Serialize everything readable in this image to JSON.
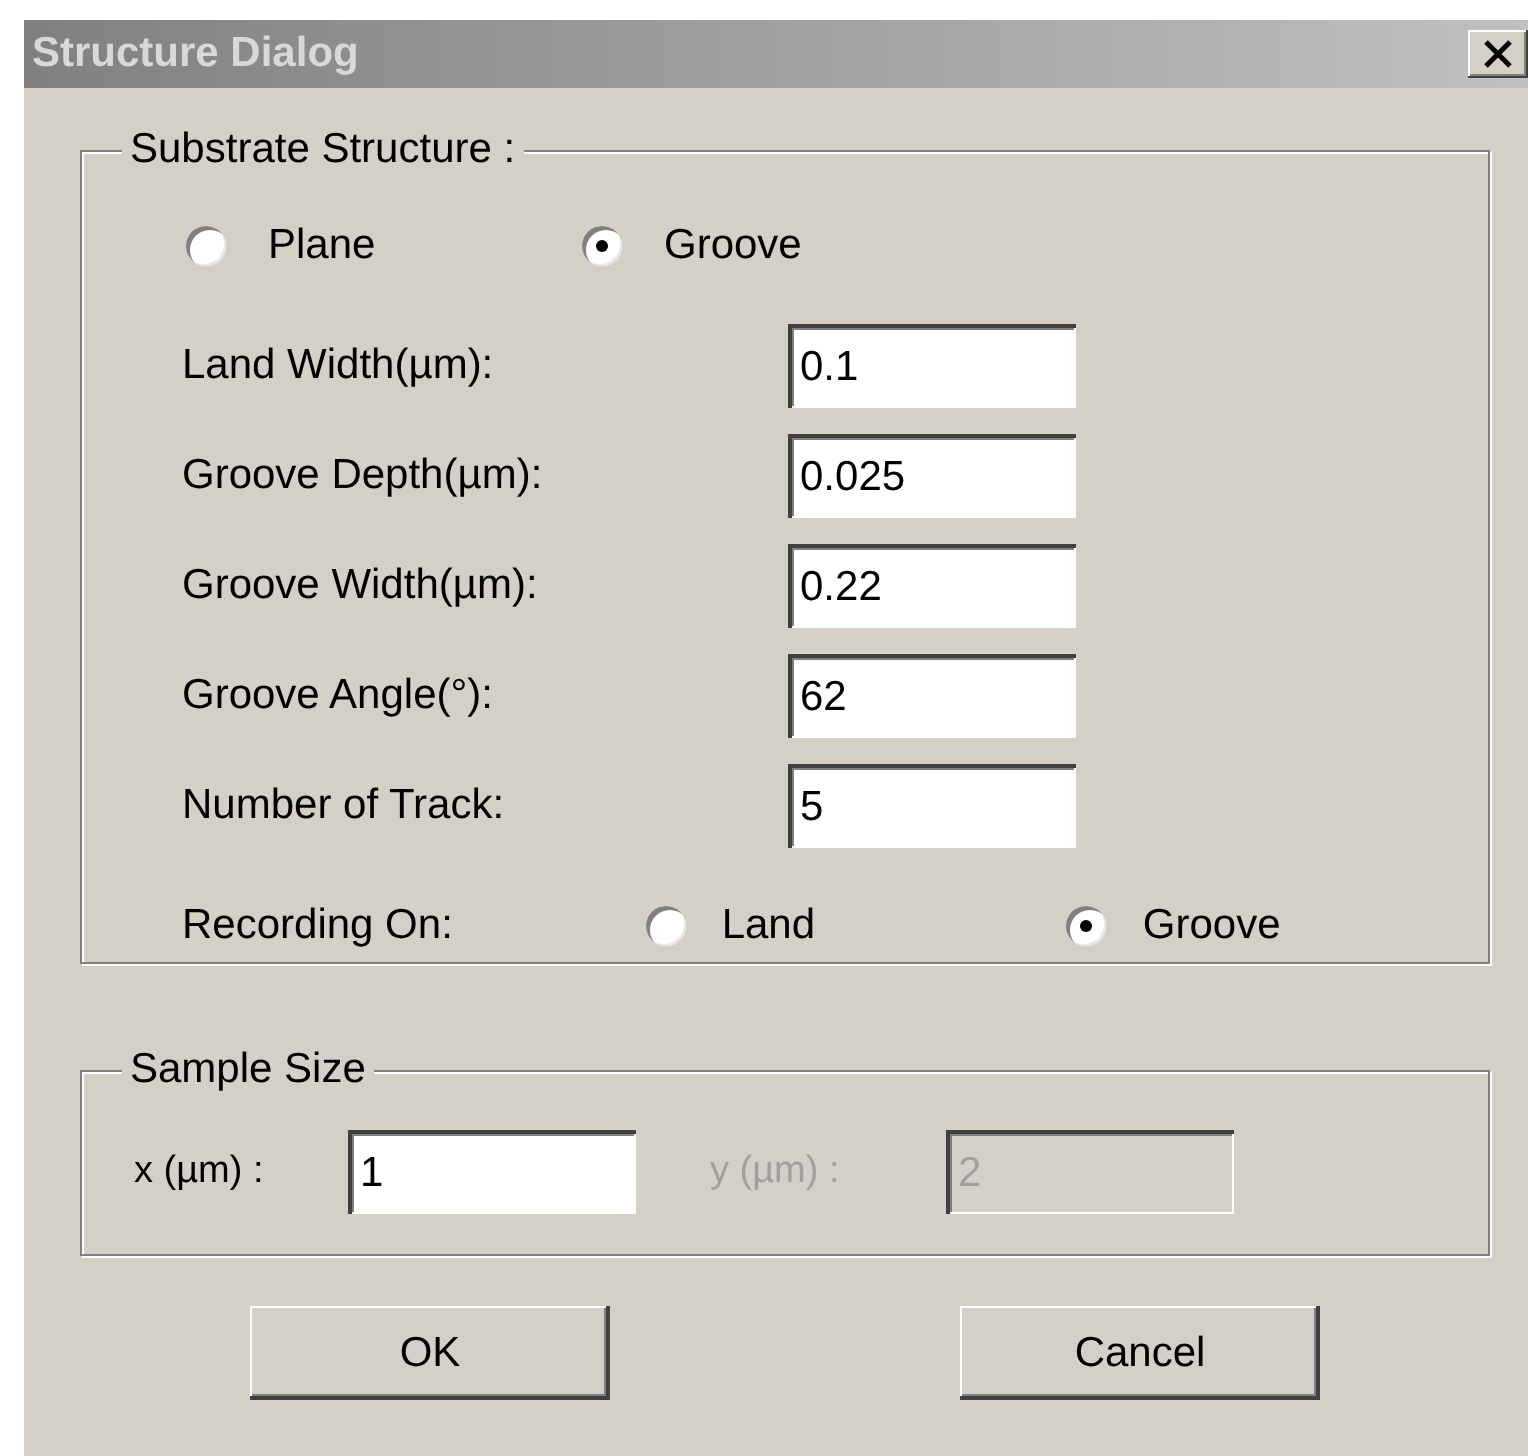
{
  "window": {
    "title": "Structure Dialog"
  },
  "substrate": {
    "legend": "Substrate Structure :",
    "types": [
      {
        "label": "Plane",
        "selected": false
      },
      {
        "label": "Groove",
        "selected": true
      }
    ],
    "fields": [
      {
        "label": "Land Width(µm):",
        "value": "0.1"
      },
      {
        "label": "Groove Depth(µm):",
        "value": "0.025"
      },
      {
        "label": "Groove Width(µm):",
        "value": "0.22"
      },
      {
        "label": "Groove Angle(°):",
        "value": "62"
      },
      {
        "label": "Number of Track:",
        "value": "5"
      }
    ],
    "recording": {
      "label": "Recording On:",
      "options": [
        {
          "label": "Land",
          "selected": false
        },
        {
          "label": "Groove",
          "selected": true
        }
      ]
    }
  },
  "sample_size": {
    "legend": "Sample Size",
    "fields": [
      {
        "label": "x (µm) :",
        "value": "1",
        "disabled": false
      },
      {
        "label": "y (µm) :",
        "value": "2",
        "disabled": true
      }
    ]
  },
  "buttons": [
    "OK",
    "Cancel"
  ]
}
